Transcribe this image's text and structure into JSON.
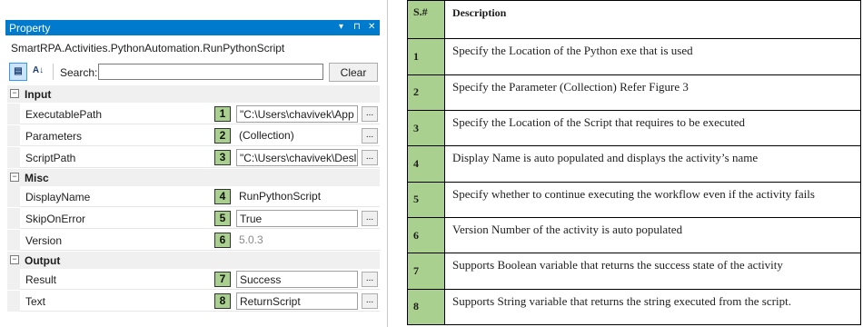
{
  "property_panel": {
    "title": "Property",
    "title_buttons": {
      "dropdown": "▾",
      "pin": "⊓",
      "close": "✕"
    },
    "type_name": "SmartRPA.Activities.PythonAutomation.RunPythonScript",
    "toolbar": {
      "categorized_icon": "categorized-icon",
      "alphabetical_icon": "sort-az-icon",
      "search_label": "Search:",
      "search_value": "",
      "clear_label": "Clear"
    },
    "collapse_glyph": "⊟",
    "ellipsis_label": "...",
    "categories": [
      {
        "label": "Input",
        "properties": [
          {
            "name": "ExecutablePath",
            "badge": "1",
            "value": "\"C:\\Users\\chavivek\\App"
          },
          {
            "name": "Parameters",
            "badge": "2",
            "value": "(Collection)"
          },
          {
            "name": "ScriptPath",
            "badge": "3",
            "value": "\"C:\\Users\\chavivek\\Desl"
          }
        ]
      },
      {
        "label": "Misc",
        "properties": [
          {
            "name": "DisplayName",
            "badge": "4",
            "value": "RunPythonScript"
          },
          {
            "name": "SkipOnError",
            "badge": "5",
            "value": "True"
          },
          {
            "name": "Version",
            "badge": "6",
            "value": "5.0.3"
          }
        ]
      },
      {
        "label": "Output",
        "properties": [
          {
            "name": "Result",
            "badge": "7",
            "value": "Success"
          },
          {
            "name": "Text",
            "badge": "8",
            "value": "ReturnScript"
          }
        ]
      }
    ]
  },
  "description_table": {
    "headers": [
      "S.#",
      "Description"
    ],
    "rows": [
      {
        "num": "1",
        "text": "Specify the Location of the Python exe that is used"
      },
      {
        "num": "2",
        "text": "Specify the Parameter (Collection) Refer Figure 3"
      },
      {
        "num": "3",
        "text": "Specify the  Location of the Script that requires to be executed"
      },
      {
        "num": "4",
        "text": "Display Name is auto populated and displays the activity’s name"
      },
      {
        "num": "5",
        "text": "Specify whether to continue executing the workflow even if the activity fails"
      },
      {
        "num": "6",
        "text": "Version Number of the activity is auto populated"
      },
      {
        "num": "7",
        "text": "Supports Boolean variable that returns the success state of the activity"
      },
      {
        "num": "8",
        "text": "Supports String variable that returns the string executed from the script."
      }
    ]
  },
  "colors": {
    "title_bar": "#007acc",
    "badge_fill": "#a9d08e",
    "category_bg": "#f0f0f0"
  }
}
